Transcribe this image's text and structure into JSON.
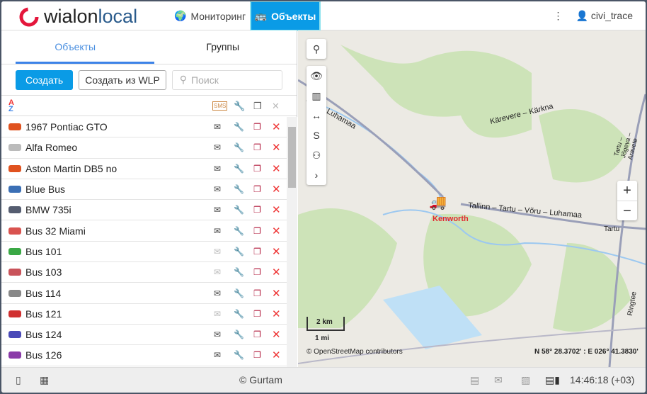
{
  "header": {
    "logo": "wialonlocal",
    "nav_monitoring": "Мониторинг",
    "nav_objects": "Объекты",
    "user": "civi_trace"
  },
  "panel": {
    "tabs": [
      "Объекты",
      "Группы"
    ],
    "create": "Создать",
    "create_wlp": "Создать из WLP",
    "search_placeholder": "Поиск",
    "sms": "SMS"
  },
  "units": [
    {
      "name": "1967 Pontiac GTO",
      "color": "#e0521f",
      "msg": true
    },
    {
      "name": "Alfa Romeo",
      "color": "#bbbbbb",
      "msg": true
    },
    {
      "name": "Aston Martin DB5 no",
      "color": "#e0521f",
      "msg": true
    },
    {
      "name": "Blue Bus",
      "color": "#3b6fb5",
      "msg": true
    },
    {
      "name": "BMW 735i",
      "color": "#555d70",
      "msg": true
    },
    {
      "name": "Bus 32 Miami",
      "color": "#d9534f",
      "msg": true
    },
    {
      "name": "Bus 101",
      "color": "#3aa845",
      "msg": false
    },
    {
      "name": "Bus 103",
      "color": "#c9535a",
      "msg": false
    },
    {
      "name": "Bus 114",
      "color": "#888888",
      "msg": true
    },
    {
      "name": "Bus 121",
      "color": "#d03030",
      "msg": false
    },
    {
      "name": "Bus 124",
      "color": "#4a4ab8",
      "msg": true
    },
    {
      "name": "Bus 126",
      "color": "#8a3aa8",
      "msg": true
    }
  ],
  "map": {
    "unit_label": "Kenworth",
    "scale_km": "2 km",
    "scale_mi": "1 mi",
    "attribution": "© OpenStreetMap contributors",
    "coords": "N 58° 28.3702' : E 026° 41.3830'",
    "roads": [
      "Tallinn – Tartu – Võru – Luhamaa",
      "Kärevere – Kärkna",
      "Võru – Luhamaa",
      "Tartu – Jõgeva – Aravete",
      "Tartu",
      "Ringtee"
    ]
  },
  "footer": {
    "copyright": "© Gurtam",
    "time": "14:46:18 (+03)"
  }
}
